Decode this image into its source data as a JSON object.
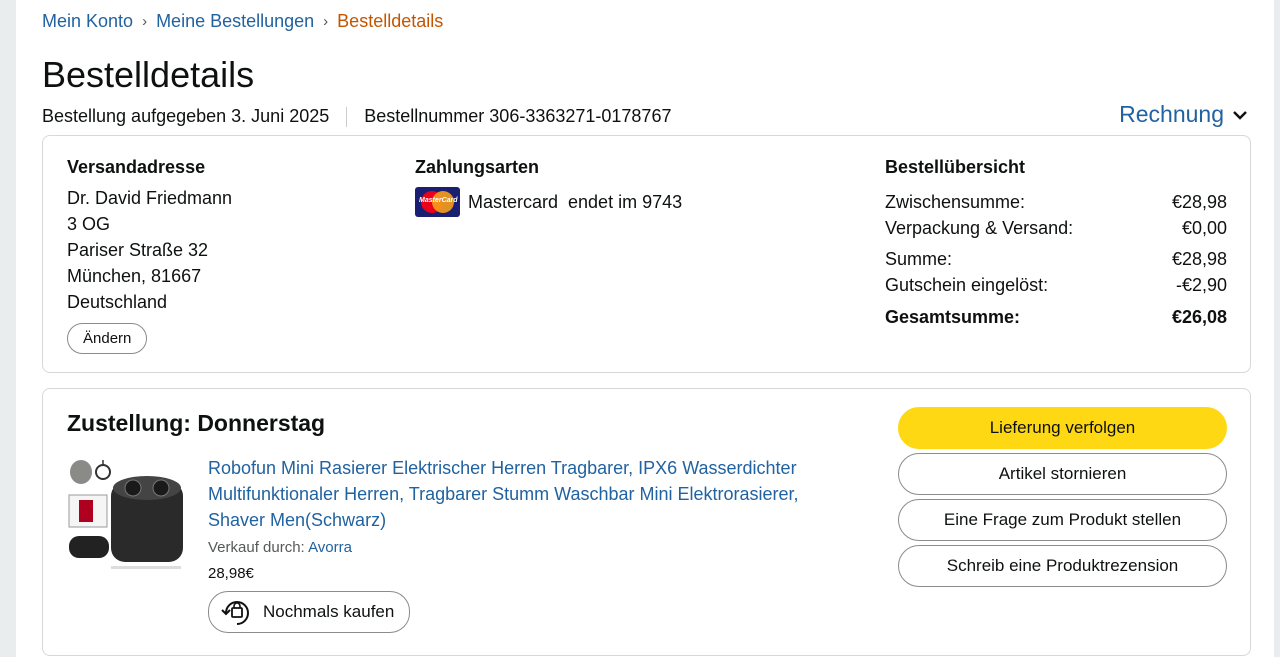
{
  "breadcrumb": {
    "items": [
      "Mein Konto",
      "Meine Bestellungen"
    ],
    "current": "Bestelldetails",
    "separator": "›"
  },
  "page_title": "Bestelldetails",
  "order_meta": {
    "placed": "Bestellung aufgegeben 3. Juni 2025",
    "number": "Bestellnummer 306-3363271-0178767"
  },
  "invoice_label": "Rechnung",
  "shipping": {
    "heading": "Versandadresse",
    "lines": [
      "Dr. David Friedmann",
      "3 OG",
      "Pariser Straße 32",
      "München, 81667",
      "Deutschland"
    ],
    "change_label": "Ändern"
  },
  "payment": {
    "heading": "Zahlungsarten",
    "card_label": "Mastercard  endet im 9743",
    "card_logo_text": "MasterCard",
    "card_icon": "mastercard-icon"
  },
  "summary": {
    "heading": "Bestellübersicht",
    "subtotal_label": "Zwischensumme:",
    "subtotal": "€28,98",
    "shipping_label": "Verpackung & Versand:",
    "shipping": "€0,00",
    "sum_label": "Summe:",
    "sum": "€28,98",
    "coupon_label": "Gutschein eingelöst:",
    "coupon": "-€2,90",
    "total_label": "Gesamtsumme:",
    "total": "€26,08"
  },
  "delivery": {
    "title": "Zustellung: Donnerstag",
    "product": {
      "title": "Robofun Mini Rasierer Elektrischer Herren Tragbarer, IPX6 Wasserdichter Multifunktionaler Herren, Tragbarer Stumm Waschbar Mini Elektrorasierer, Shaver Men(Schwarz)",
      "seller_prefix": "Verkauf durch:",
      "seller": "Avorra",
      "price": "28,98€",
      "rebuy_label": "Nochmals kaufen"
    },
    "actions": [
      "Lieferung verfolgen",
      "Artikel stornieren",
      "Eine Frage zum Produkt stellen",
      "Schreib eine Produktrezension"
    ]
  },
  "colors": {
    "link": "#2162a1",
    "breadcrumb_current": "#c45500",
    "primary_button": "#ffd814",
    "border": "#d5d9d9"
  }
}
